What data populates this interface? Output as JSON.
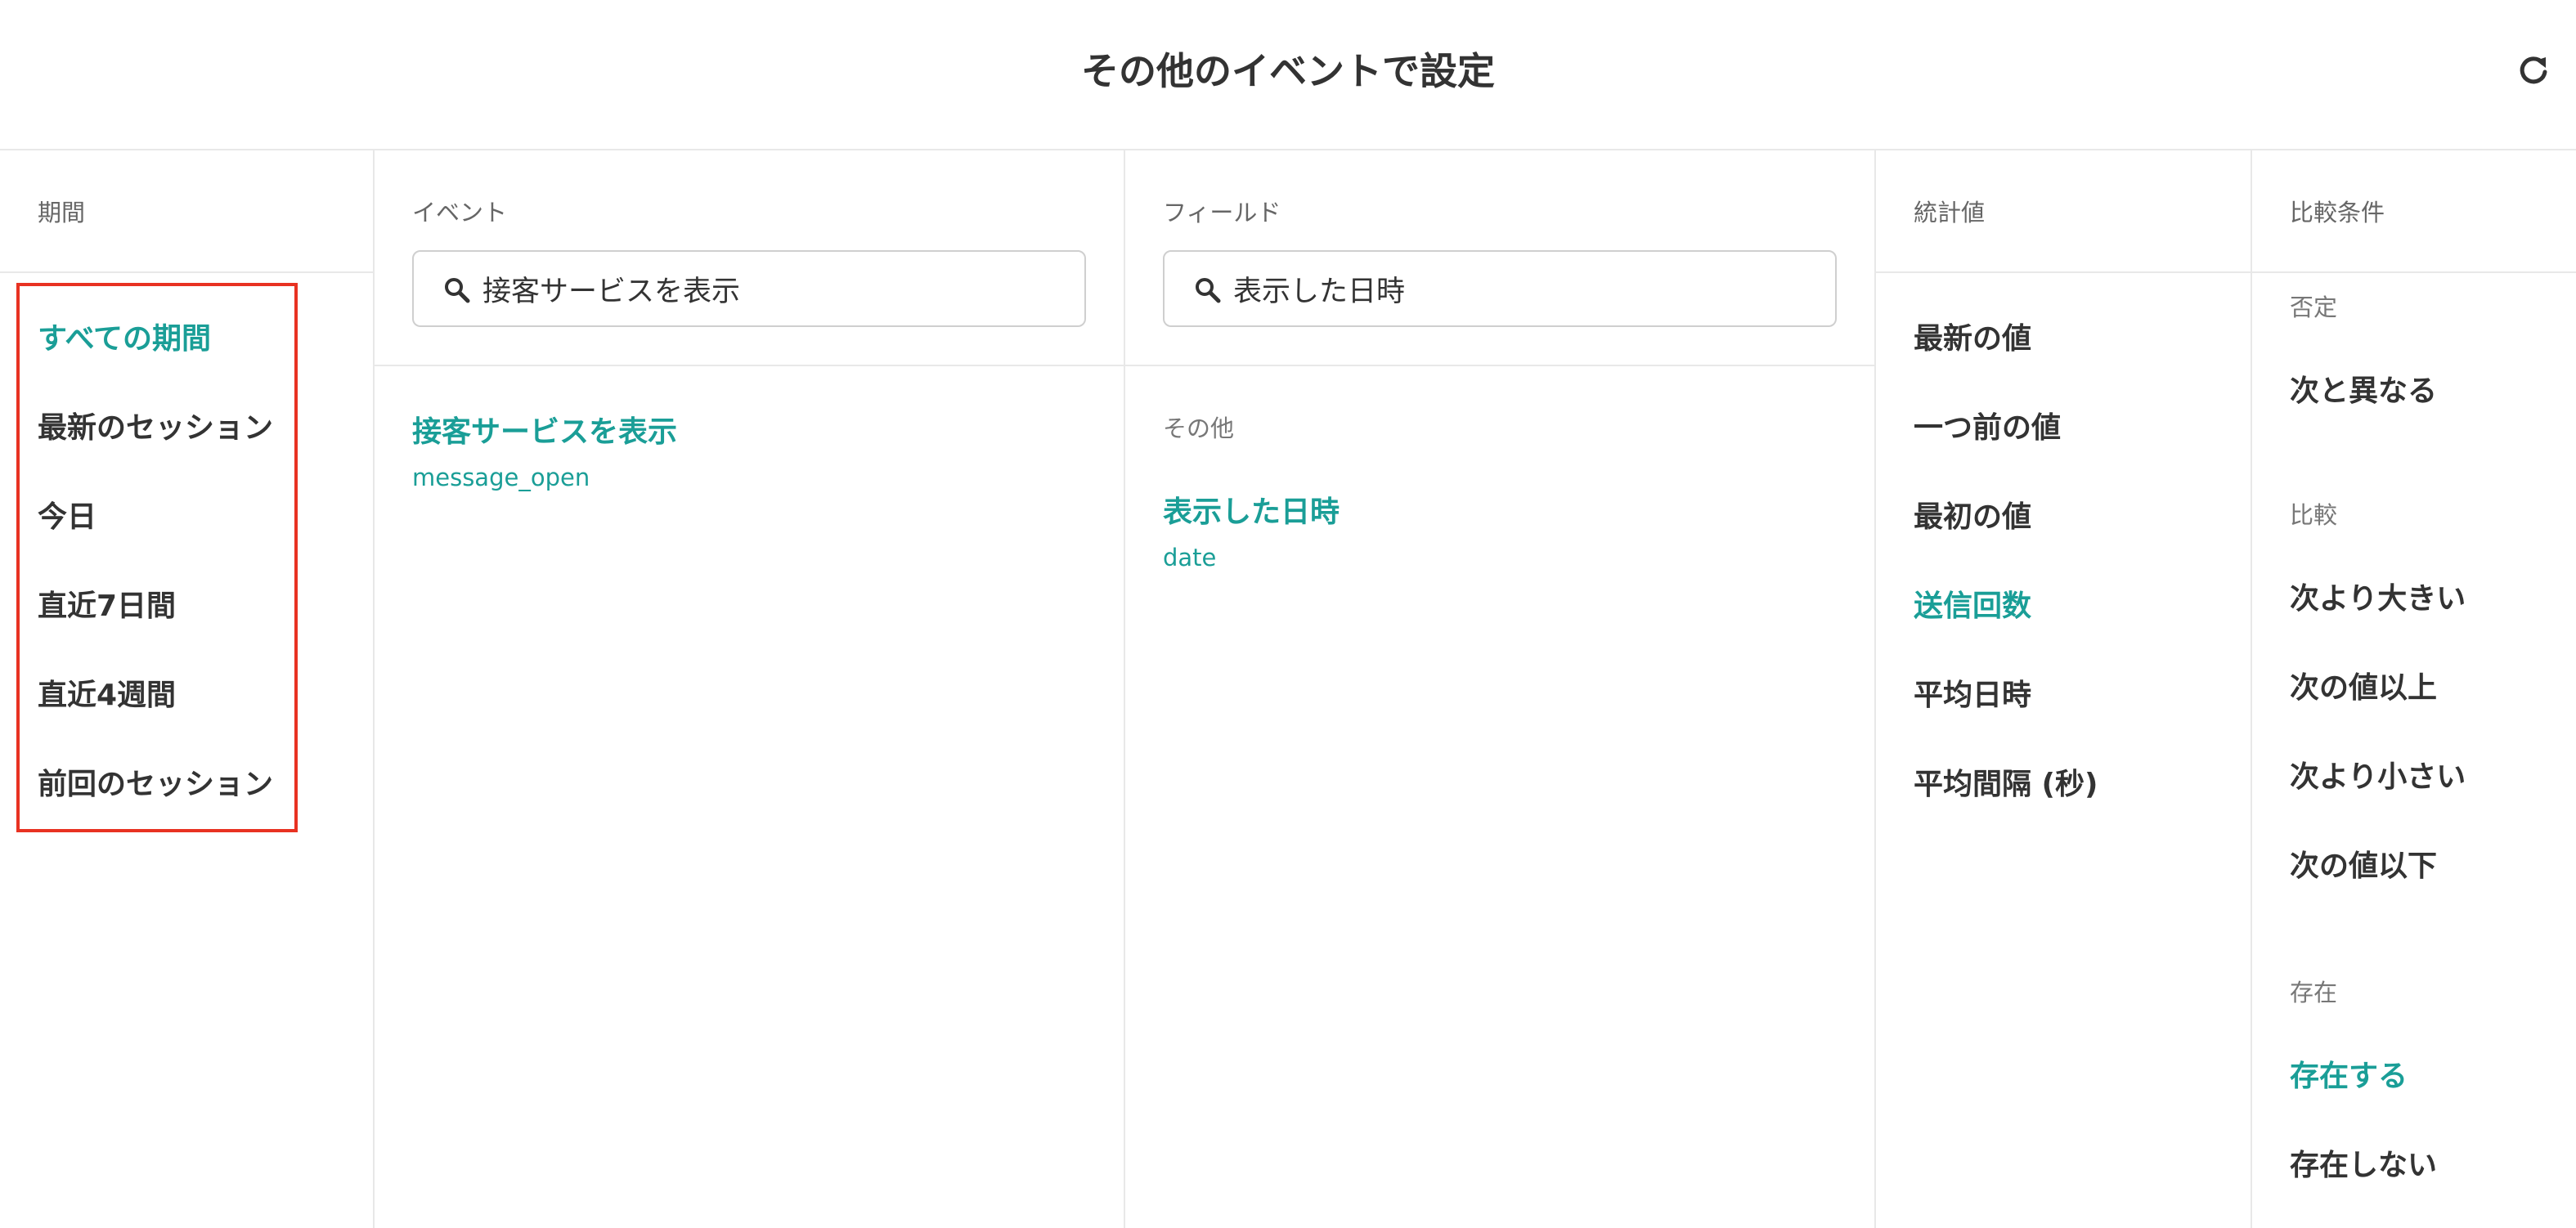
{
  "header": {
    "title": "その他のイベントで設定",
    "refresh_icon": "refresh-icon"
  },
  "period": {
    "label": "期間",
    "items": [
      {
        "label": "すべての期間",
        "active": true
      },
      {
        "label": "最新のセッション",
        "active": false
      },
      {
        "label": "今日",
        "active": false
      },
      {
        "label": "直近7日間",
        "active": false
      },
      {
        "label": "直近4週間",
        "active": false
      },
      {
        "label": "前回のセッション",
        "active": false
      }
    ]
  },
  "event": {
    "label": "イベント",
    "search_value": "接客サービスを表示",
    "results": [
      {
        "label": "接客サービスを表示",
        "key": "message_open"
      }
    ]
  },
  "field": {
    "label": "フィールド",
    "search_value": "表示した日時",
    "group": "その他",
    "results": [
      {
        "label": "表示した日時",
        "key": "date"
      }
    ]
  },
  "stat": {
    "label": "統計値",
    "items": [
      {
        "label": "最新の値",
        "active": false
      },
      {
        "label": "一つ前の値",
        "active": false
      },
      {
        "label": "最初の値",
        "active": false
      },
      {
        "label": "送信回数",
        "active": true
      },
      {
        "label": "平均日時",
        "active": false
      },
      {
        "label": "平均間隔 (秒)",
        "active": false
      }
    ]
  },
  "compare": {
    "label": "比較条件",
    "groups": [
      {
        "label": "否定",
        "items": [
          "次と異なる"
        ]
      },
      {
        "label": "比較",
        "items": [
          "次より大きい",
          "次の値以上",
          "次より小さい",
          "次の値以下"
        ]
      },
      {
        "label": "存在",
        "items": [
          "存在する",
          "存在しない"
        ]
      }
    ],
    "active_item": "存在する"
  },
  "colors": {
    "accent": "#1a9e97",
    "text": "#333333",
    "highlight_border": "#e83222"
  }
}
